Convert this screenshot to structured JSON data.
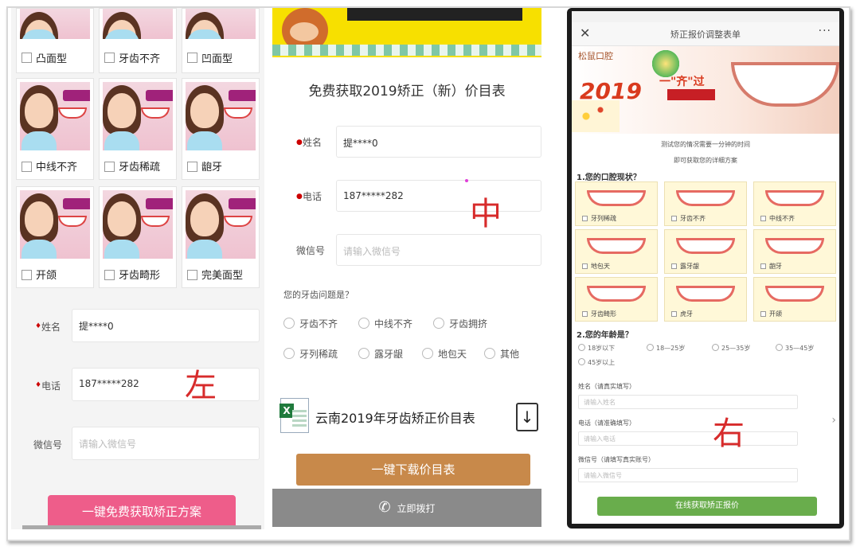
{
  "left": {
    "grid": [
      {
        "label": "凸面型"
      },
      {
        "label": "牙齿不齐"
      },
      {
        "label": "凹面型"
      },
      {
        "label": "中线不齐"
      },
      {
        "label": "牙齿稀疏"
      },
      {
        "label": "龅牙"
      },
      {
        "label": "开颌"
      },
      {
        "label": "牙齿畸形"
      },
      {
        "label": "完美面型"
      }
    ],
    "form": {
      "name_label": "姓名",
      "name_value": "提****0",
      "phone_label": "电话",
      "phone_value": "187*****282",
      "wechat_label": "微信号",
      "wechat_placeholder": "请输入微信号"
    },
    "submit_label": "一键免费获取矫正方案",
    "overlay_char": "左"
  },
  "middle": {
    "title": "免费获取2019矫正（新）价目表",
    "form": {
      "name_label": "姓名",
      "name_value": "提****0",
      "phone_label": "电话",
      "phone_value": "187*****282",
      "wechat_label": "微信号",
      "wechat_placeholder": "请输入微信号"
    },
    "question": "您的牙齿问题是？",
    "options": [
      "牙齿不齐",
      "中线不齐",
      "牙齿拥挤",
      "牙列稀疏",
      "露牙龈",
      "地包天",
      "其他"
    ],
    "doc_title": "云南2019年牙齿矫正价目表",
    "download_label": "一键下载价目表",
    "call_label": "立即拨打",
    "overlay_char": "中"
  },
  "right": {
    "nav_title": "矫正报价调整表单",
    "nav_more": "···",
    "hero_logo": "松鼠口腔",
    "hero_year": "2019",
    "hero_slogan": "一\"齐\"过",
    "line1": "测试您的情况需要一分钟的时间",
    "line2": "即可获取您的详细方案",
    "q1": "1.您的口腔现状？",
    "conditions": [
      "牙列稀疏",
      "牙齿不齐",
      "中线不齐",
      "地包天",
      "露牙龈",
      "龅牙",
      "牙齿畸形",
      "虎牙",
      "开颌"
    ],
    "q2": "2.您的年龄是？",
    "ages": [
      "18岁以下",
      "18—25岁",
      "25—35岁",
      "35—45岁",
      "45岁以上"
    ],
    "name_label": "姓名（请真实填写）",
    "name_placeholder": "请输入姓名",
    "phone_label": "电话（请准确填写）",
    "phone_placeholder": "请输入电话",
    "wechat_label": "微信号（请填写真实账号）",
    "wechat_placeholder": "请输入微信号",
    "submit_label": "在线获取矫正报价",
    "overlay_char": "右"
  }
}
